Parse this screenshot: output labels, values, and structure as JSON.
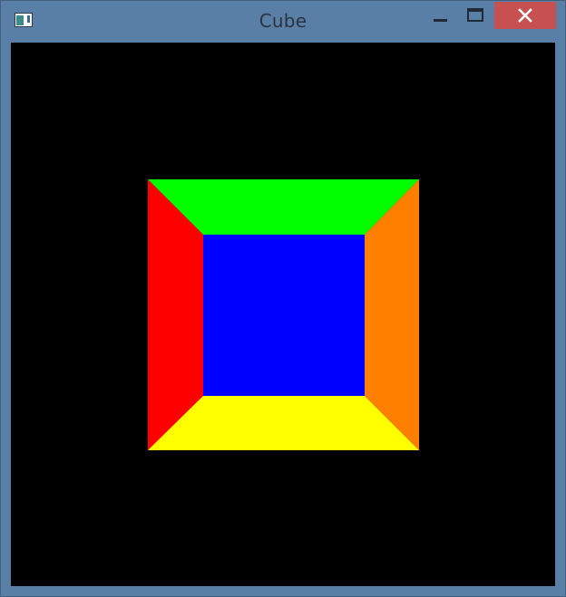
{
  "window": {
    "title": "Cube",
    "app_icon": "window-app-icon",
    "controls": {
      "minimize_icon": "minimize-icon",
      "maximize_icon": "maximize-icon",
      "close_icon": "close-icon"
    },
    "colors": {
      "frame": "#5a7fa6",
      "close_button": "#c75050"
    }
  },
  "viewport": {
    "background": "#000000",
    "faces": [
      {
        "name": "top",
        "color": "#00ff00"
      },
      {
        "name": "left",
        "color": "#ff0000"
      },
      {
        "name": "right",
        "color": "#ff8000"
      },
      {
        "name": "bottom",
        "color": "#ffff00"
      },
      {
        "name": "front",
        "color": "#0000ff"
      }
    ]
  }
}
